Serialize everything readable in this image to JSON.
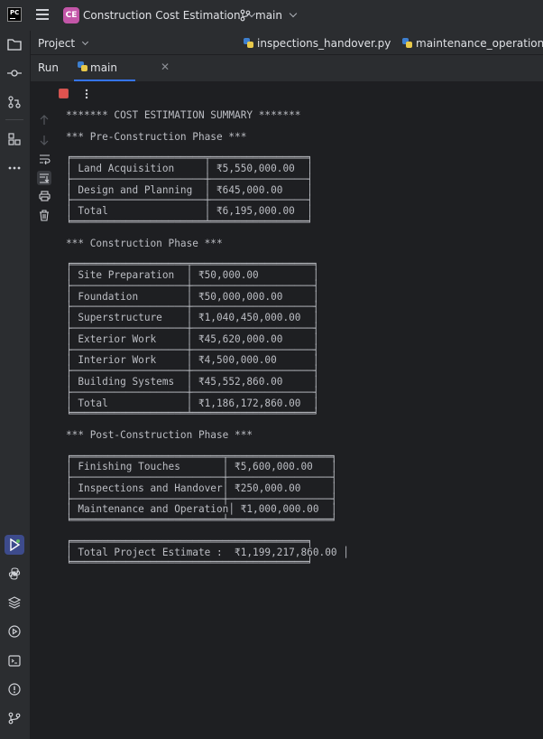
{
  "app": {
    "logo": "PC",
    "project_initials": "CE",
    "project_name": "Construction Cost Estimation",
    "branch": "main"
  },
  "tabs": {
    "project_label": "Project",
    "files": [
      "inspections_handover.py",
      "maintenance_operation.py"
    ]
  },
  "run": {
    "label": "Run",
    "config_name": "main"
  },
  "console": {
    "lines": [
      "******* COST ESTIMATION SUMMARY *******",
      "",
      "*** Pre-Construction Phase ***",
      "",
      "╒══════════════════════╤════════════════╕",
      "│ Land Acquisition     │ ₹5,550,000.00  │",
      "├──────────────────────┼────────────────┤",
      "│ Design and Planning  │ ₹645,000.00    │",
      "├──────────────────────┼────────────────┤",
      "│ Total                │ ₹6,195,000.00  │",
      "╘══════════════════════╧════════════════╛",
      "",
      "*** Construction Phase ***",
      "",
      "╒═══════════════════╤════════════════════╕",
      "│ Site Preparation  │ ₹50,000.00         │",
      "├───────────────────┼────────────────────┤",
      "│ Foundation        │ ₹50,000,000.00     │",
      "├───────────────────┼────────────────────┤",
      "│ Superstructure    │ ₹1,040,450,000.00  │",
      "├───────────────────┼────────────────────┤",
      "│ Exterior Work     │ ₹45,620,000.00     │",
      "├───────────────────┼────────────────────┤",
      "│ Interior Work     │ ₹4,500,000.00      │",
      "├───────────────────┼────────────────────┤",
      "│ Building Systems  │ ₹45,552,860.00     │",
      "├───────────────────┼────────────────────┤",
      "│ Total             │ ₹1,186,172,860.00  │",
      "╘═══════════════════╧════════════════════╛",
      "",
      "*** Post-Construction Phase ***",
      "",
      "╒═════════════════════════╤═════════════════╕",
      "│ Finishing Touches       │ ₹5,600,000.00   │",
      "├─────────────────────────┼─────────────────┤",
      "│ Inspections and Handover│ ₹250,000.00     │",
      "├─────────────────────────┼─────────────────┤",
      "│ Maintenance and Operation│ ₹1,000,000.00  │",
      "╘═════════════════════════╧═════════════════╛",
      "",
      "╒═══════════════════════════════════════╕",
      "│ Total Project Estimate :  ₹1,199,217,860.00 │",
      "╘═══════════════════════════════════════╛"
    ]
  }
}
